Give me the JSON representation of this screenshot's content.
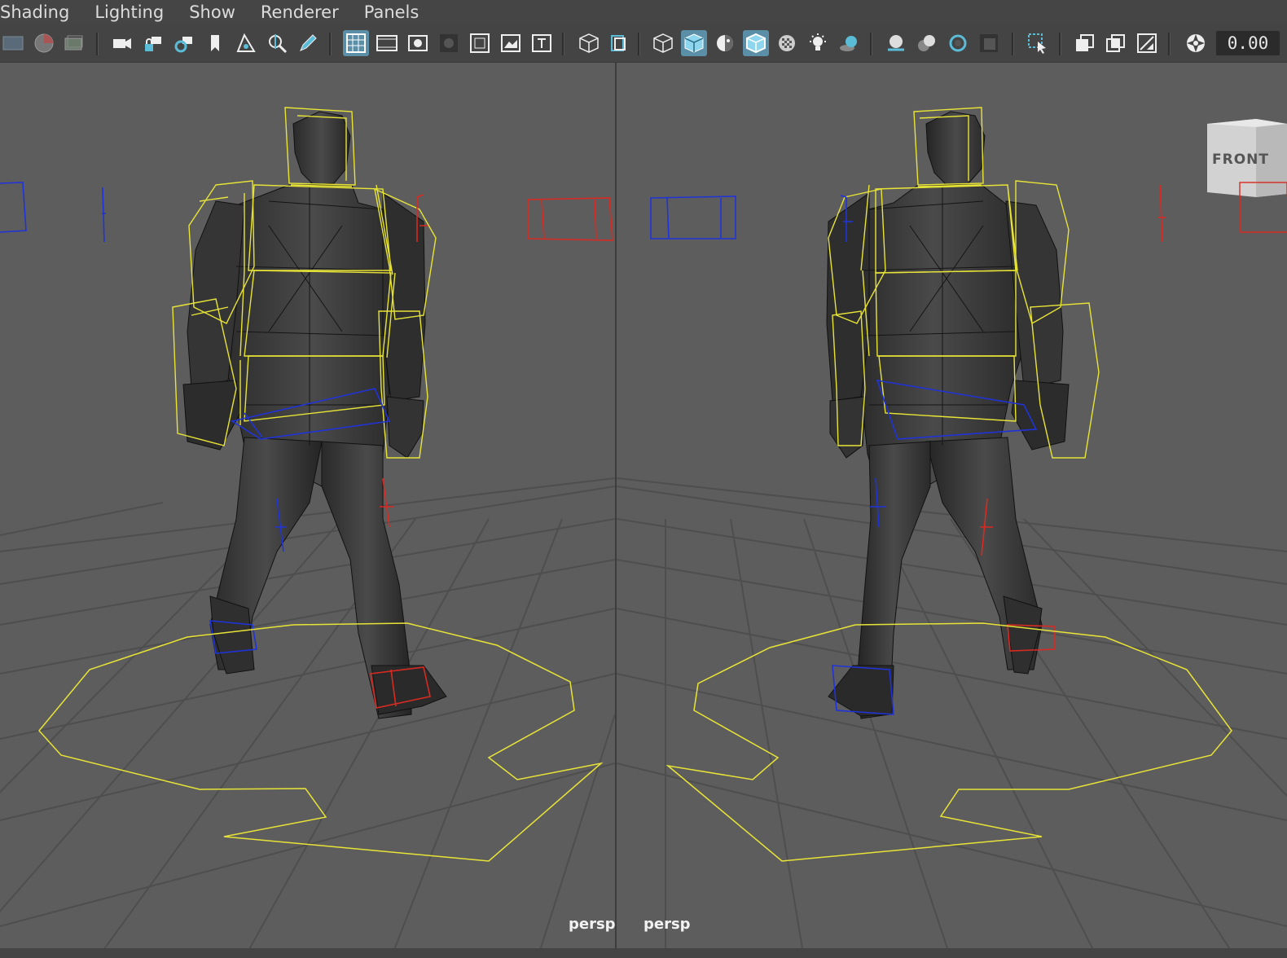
{
  "menubar": {
    "items": [
      "Shading",
      "Lighting",
      "Show",
      "Renderer",
      "Panels"
    ]
  },
  "toolbar": {
    "icons": [
      "select-camera-icon",
      "camera-attributes-icon",
      "bookmarks-icon",
      "camera-icon",
      "lock-camera-icon",
      "camera-attributes-2-icon",
      "bookmark-icon",
      "image-plane-icon",
      "2d-pan-zoom-icon",
      "grease-pencil-icon",
      "grid-icon",
      "film-gate-icon",
      "resolution-gate-icon",
      "gate-mask-icon",
      "field-chart-icon",
      "safe-action-icon",
      "safe-title-icon",
      "wireframe-cube-icon",
      "wireframe-on-shaded-icon",
      "smooth-shade-icon",
      "solid-cube-icon",
      "flat-shade-icon",
      "wireframe-shaded-icon",
      "textured-icon",
      "use-lights-icon",
      "shadows-icon",
      "ambient-occlusion-icon",
      "motion-blur-icon",
      "anti-alias-icon",
      "depth-of-field-icon",
      "isolate-select-icon",
      "xray-icon",
      "xray-joints-icon",
      "xray-components-icon",
      "exposure-icon"
    ],
    "exposure_value": "0.00"
  },
  "viewports": {
    "left": {
      "camera": "persp"
    },
    "right": {
      "camera": "persp"
    }
  },
  "viewcube": {
    "face_label": "FRONT"
  },
  "colors": {
    "viewport_bg": "#5d5d5d",
    "control_yellow": "#e8e437",
    "control_blue": "#2033d8",
    "control_red": "#d82a22",
    "mesh_dark": "#333333",
    "active_button": "#5b8fa8"
  }
}
